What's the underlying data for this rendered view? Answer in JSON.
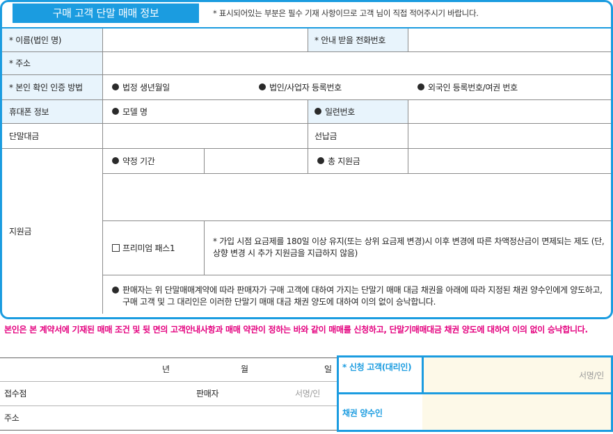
{
  "header": {
    "title": "구매 고객 단말 매매 정보",
    "note": "* 표시되어있는  부분은 필수 기재 사항이므로 고객 님이 직접 적어주시기 바랍니다."
  },
  "rows": {
    "name_label": "* 이름(법인 명)",
    "phone_label": "* 안내 받을 전화번호",
    "address_label": "* 주소",
    "verify_label": "* 본인 확인 인증 방법",
    "verify_options": [
      "법정 생년월일",
      "법인/사업자 등록번호",
      "외국인 등록번호/여권 번호"
    ],
    "device_label": "휴대폰 정보",
    "model_label": "모델 명",
    "serial_label": "일련번호",
    "price_label": "단말대금",
    "prepay_label": "선납금",
    "subsidy_label": "지원금",
    "contract_label": "약정 기간",
    "total_subsidy_label": "총 지원금",
    "premium_label": "프리미엄 패스1",
    "premium_note": "* 가입 시점 요금제를 180일 이상 유지(또는 상위 요금제 변경)시 이후 변경에 따른 차액정산금이 면제되는 제도 (단, 상향 변경 시 추가 지원금을 지급하지 않음)",
    "transfer_note": "판매자는 위 단말매매계약에 따라 판매자가 구매 고객에 대하여 가지는 단말기 매매 대금 채권을 아래에 따라 지정된 채권 양수인에게 양도하고, 구매 고객 및 그 대리인은 이러한 단말기 매매 대금 채권 양도에 대하여 이의 없이 승낙합니다."
  },
  "agreement": "본인은 본 계약서에 기재된 매매 조건 및 뒷 면의 고객안내사항과 매매 약관이 정하는 바와 같이 매매를 신청하고, 단말기매매대금 채권 양도에 대하여 이의 없이 승낙합니다.",
  "footer": {
    "year": "년",
    "month": "월",
    "day": "일",
    "store_label": "접수점",
    "seller_label": "판매자",
    "sign_placeholder": "서명/인",
    "address_label": "주소",
    "applicant_label": "* 신청 고객(대리인)",
    "applicant_sign": "서명/인",
    "assignee_label": "채권 양수인"
  },
  "colors": {
    "accent": "#1b9ce0",
    "header_bg": "#e8f4fc",
    "agreement_text": "#e4007f",
    "signature_bg": "#fdf9e8"
  }
}
